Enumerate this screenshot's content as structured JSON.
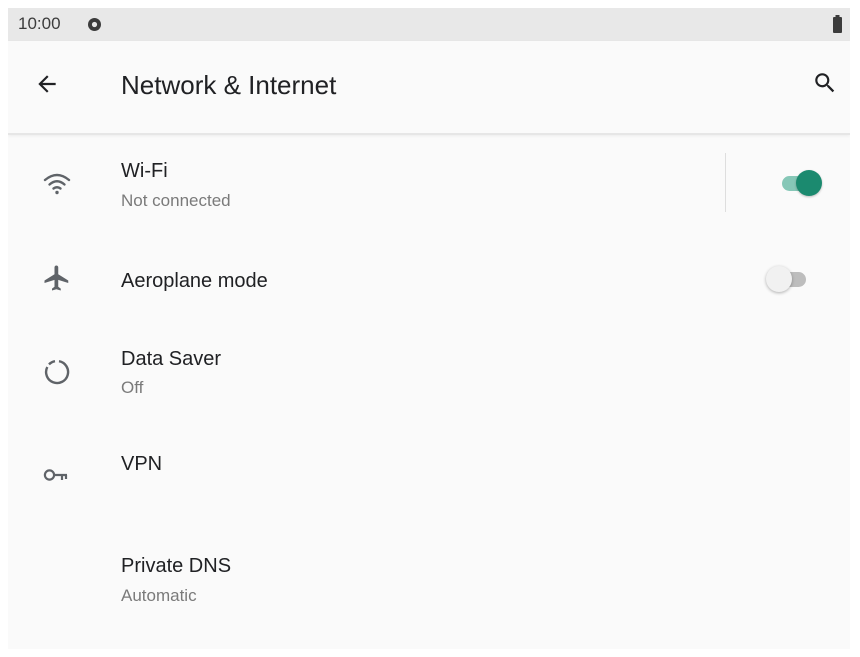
{
  "status_bar": {
    "time": "10:00",
    "notification_icon": "circle-dot-icon",
    "battery_icon": "battery-icon"
  },
  "header": {
    "title": "Network & Internet",
    "back_icon": "arrow-left-icon",
    "search_icon": "search-icon"
  },
  "colors": {
    "accent": "#1b8a6f",
    "accent_track": "#86c7b7",
    "thumb_off": "#f1f1f1",
    "track_off": "#bdbdbd"
  },
  "settings": [
    {
      "id": "wifi",
      "icon": "wifi-icon",
      "title": "Wi-Fi",
      "subtitle": "Not connected",
      "toggle": true
    },
    {
      "id": "aeroplane",
      "icon": "airplane-icon",
      "title": "Aeroplane mode",
      "toggle": false
    },
    {
      "id": "data-saver",
      "icon": "data-saver-icon",
      "title": "Data Saver",
      "subtitle": "Off"
    },
    {
      "id": "vpn",
      "icon": "vpn-key-icon",
      "title": "VPN"
    },
    {
      "id": "private-dns",
      "title": "Private DNS",
      "subtitle": "Automatic"
    }
  ]
}
